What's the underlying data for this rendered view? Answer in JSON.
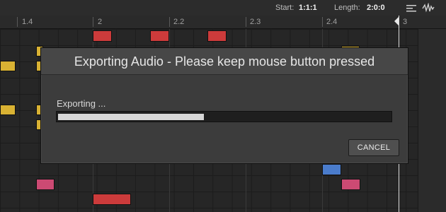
{
  "header": {
    "start_label": "Start:",
    "start_value": "1:1:1",
    "length_label": "Length:",
    "length_value": "2:0:0"
  },
  "ruler": {
    "labels": [
      "1.4",
      "2",
      "2.2",
      "2.3",
      "2.4",
      "3"
    ]
  },
  "dialog": {
    "title": "Exporting Audio - Please keep mouse button pressed",
    "status_text": "Exporting ...",
    "progress": 0.44,
    "cancel_label": "CANCEL"
  },
  "colors": {
    "note_red": "#cc3b3b",
    "note_yellow": "#d9b233",
    "note_pink": "#cc4a73",
    "note_blue": "#4a7ccc"
  }
}
